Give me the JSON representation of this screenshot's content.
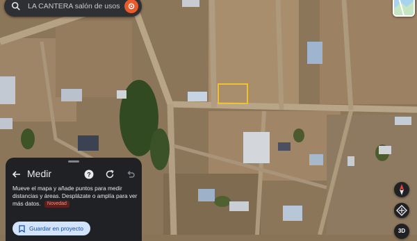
{
  "search": {
    "text": "LA CANTERA salón de usos multipl",
    "search_icon": "search-icon",
    "pin_icon": "location-pin-icon"
  },
  "layers": {
    "icon": "layers-thumbnail"
  },
  "panel": {
    "title": "Medir",
    "description": "Mueve el mapa y añade puntos para medir distancias y áreas. Desplázate o amplía para ver más datos.",
    "badge": "Novedad",
    "save_label": "Guardar en proyecto",
    "icons": [
      "back-arrow-icon",
      "help-icon",
      "refresh-icon",
      "undo-icon",
      "bookmark-icon"
    ]
  },
  "controls": {
    "three_d_label": "3D",
    "icons": [
      "compass-icon",
      "tilt-icon"
    ]
  },
  "colors": {
    "panel_bg": "#202124",
    "search_bg": "#2f3033",
    "accent_orange": "#ea5a2a",
    "button_bg": "#d2e3fc",
    "button_text": "#174ea6",
    "badge_text": "#f28b82",
    "measure_box": "#f2c12e"
  }
}
